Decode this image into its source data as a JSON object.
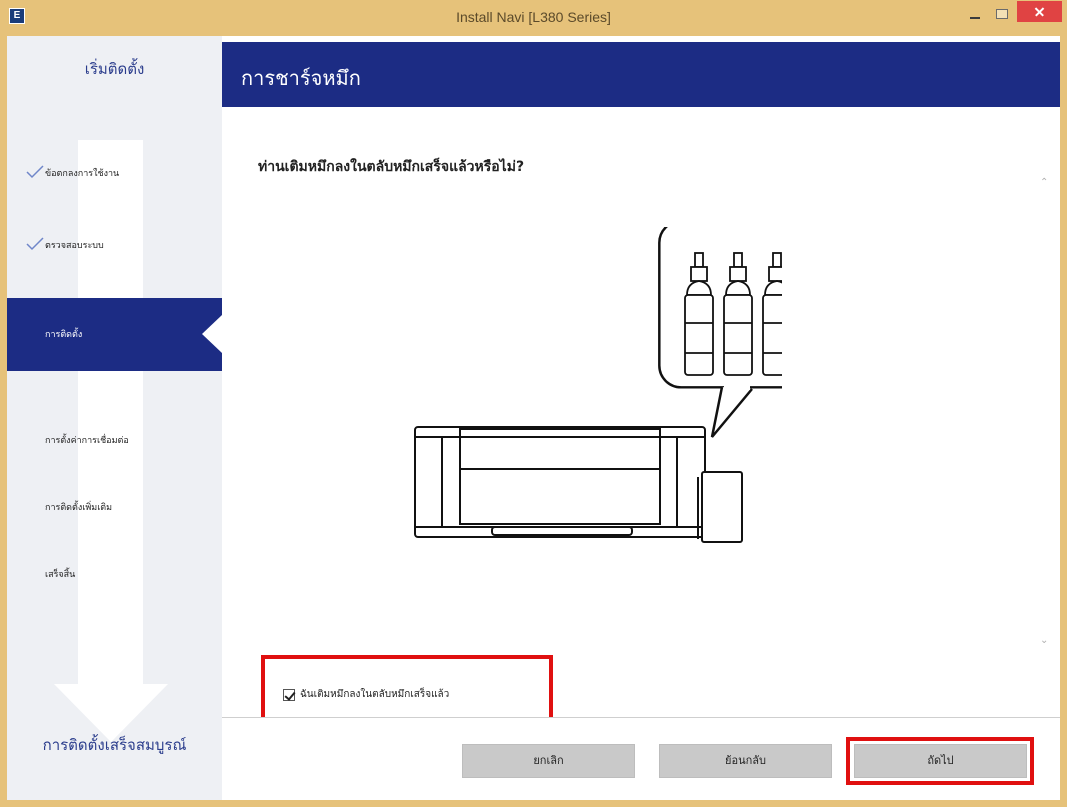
{
  "window": {
    "title": "Install Navi [L380 Series]",
    "app_icon_glyph": "E"
  },
  "sidebar": {
    "title": "เริ่มติดตั้ง",
    "steps": [
      {
        "label": "ข้อตกลงการใช้งาน",
        "state": "done"
      },
      {
        "label": "ตรวจสอบระบบ",
        "state": "done"
      },
      {
        "label": "การติดตั้ง",
        "state": "active"
      },
      {
        "label": "การตั้งค่าการเชื่อมต่อ",
        "state": "pending"
      },
      {
        "label": "การติดตั้งเพิ่มเติม",
        "state": "pending"
      },
      {
        "label": "เสร็จสิ้น",
        "state": "pending"
      }
    ],
    "bottom": "การติดตั้งเสร็จสมบูรณ์"
  },
  "header": {
    "title": "การชาร์จหมึก"
  },
  "content": {
    "question": "ท่านเติมหมึกลงในตลับหมึกเสร็จแล้วหรือไม่?",
    "checkbox_label": "ฉันเติมหมึกลงในตลับหมึกเสร็จแล้ว",
    "checkbox_checked": true
  },
  "footer": {
    "cancel": "ยกเลิก",
    "back": "ย้อนกลับ",
    "next": "ถัดไป"
  },
  "colors": {
    "accent": "#1c2c84",
    "highlight": "#e01010",
    "titlebar": "#e6c27a"
  }
}
